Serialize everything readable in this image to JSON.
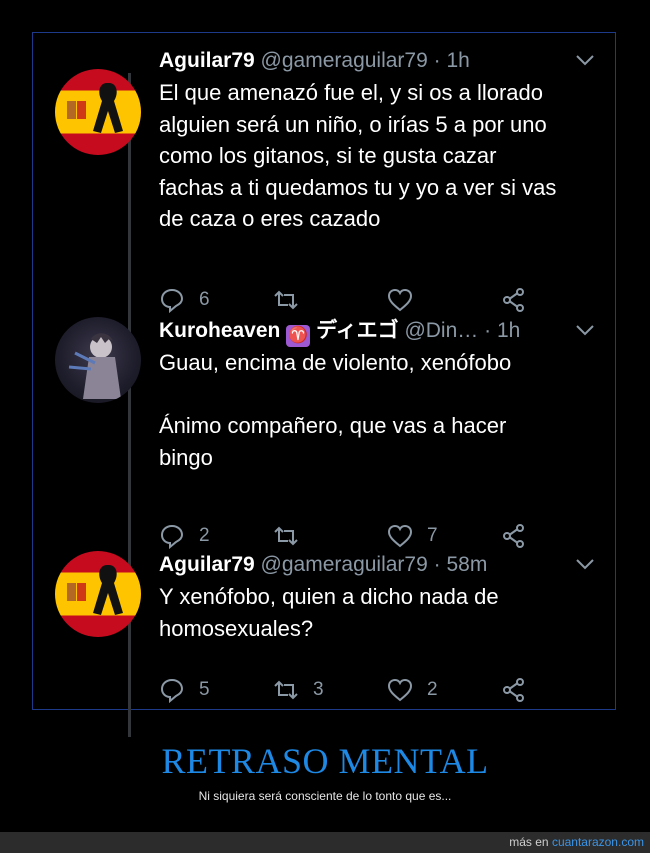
{
  "tweets": [
    {
      "name": "Aguilar79",
      "handle": "@gameraguilar79",
      "time": "1h",
      "text": "El que amenazó fue el, y si os a llorado\nalguien será un niño, o irías 5 a por uno\ncomo los gitanos, si te gusta cazar\nfachas a ti quedamos tu y yo a ver si vas\nde caza o eres cazado",
      "replies": "6",
      "retweets": "",
      "likes": ""
    },
    {
      "name": "Kuroheaven",
      "name_symbol": "♈",
      "name_suffix": "ディエゴ",
      "handle": "@Din…",
      "time": "1h",
      "text": "Guau, encima de violento, xenófobo\n\nÁnimo compañero, que vas a hacer\nbingo",
      "replies": "2",
      "retweets": "",
      "likes": "7"
    },
    {
      "name": "Aguilar79",
      "handle": "@gameraguilar79",
      "time": "58m",
      "text": "Y xenófobo, quien a dicho nada de\nhomosexuales?",
      "replies": "5",
      "retweets": "3",
      "likes": "2"
    }
  ],
  "separator": "·",
  "icons": {
    "reply": "reply-icon",
    "retweet": "retweet-icon",
    "like": "heart-icon",
    "share": "share-icon",
    "menu": "chevron-down-icon"
  },
  "caption": {
    "title": "RETRASO MENTAL",
    "subtitle": "Ni siquiera será consciente de lo tonto que es..."
  },
  "footer": {
    "prefix": "más en",
    "link": "cuantarazon.com"
  },
  "colors": {
    "background": "#000000",
    "handle": "#8b98a5",
    "caption": "#1e88e5",
    "frame_border": "#1d3a8a",
    "link": "#3b94e6"
  }
}
